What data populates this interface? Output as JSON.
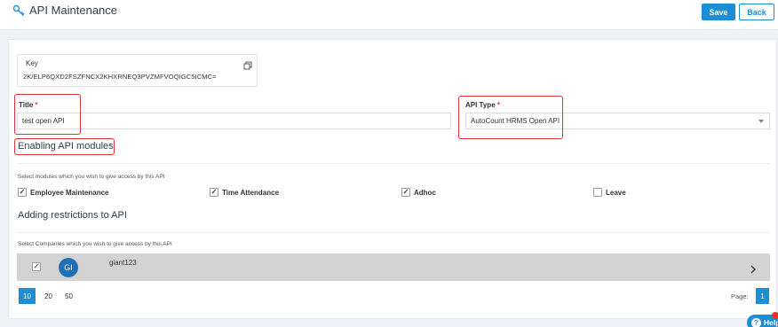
{
  "header": {
    "title": "API Maintenance",
    "title_icon": "key-icon",
    "save_label": "Save",
    "back_label": "Back"
  },
  "key": {
    "label": "Key",
    "value": "2K/ELP6QXD2FSZFNCX2KHXRNEQ3PVZMFVOQIGC5ICMC="
  },
  "form": {
    "title_label": "Title",
    "title_value": "test open API",
    "api_type_label": "API Type",
    "api_type_value": "AutoCount HRMS Open API",
    "required_mark": "*"
  },
  "modules": {
    "heading": "Enabling API modules",
    "hint": "Select modules which you wish to give access by this API",
    "items": [
      {
        "label": "Employee Maintenance",
        "checked": true
      },
      {
        "label": "Time Attendance",
        "checked": true
      },
      {
        "label": "Adhoc",
        "checked": true
      },
      {
        "label": "Leave",
        "checked": false
      }
    ]
  },
  "restrictions": {
    "heading": "Adding restrictions to API",
    "hint": "Select Companies which you wish to give access by this API",
    "companies": [
      {
        "initials": "GI",
        "name": "giant123",
        "checked": true
      }
    ]
  },
  "pagination": {
    "page_sizes": [
      "10",
      "20",
      "50"
    ],
    "active_size": "10",
    "page_label": "Page:",
    "current_page": "1"
  },
  "help": {
    "label": "Help"
  },
  "colors": {
    "primary": "#1a8fd8",
    "highlight_border": "#d9363e",
    "row_bg": "#d3d3d3",
    "avatar": "#1f6fb5"
  }
}
